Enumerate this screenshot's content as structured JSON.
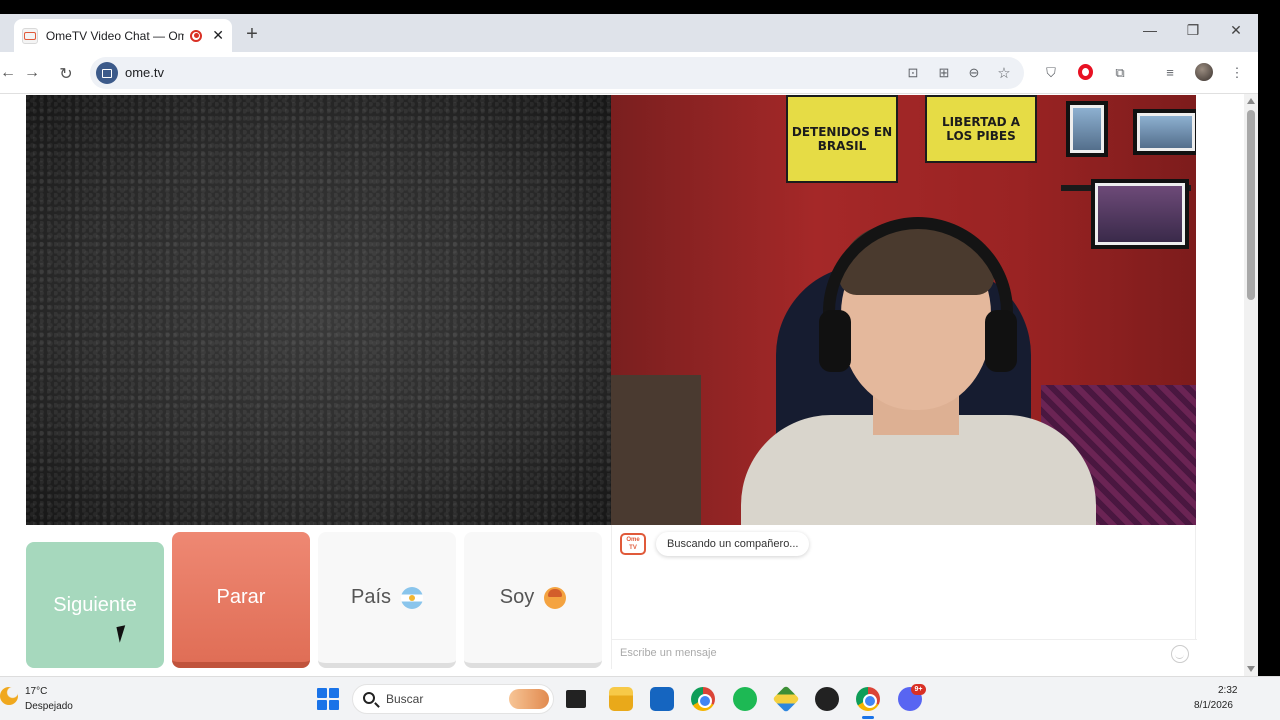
{
  "browser": {
    "tab": {
      "title": "OmeTV Video Chat — Ome",
      "favicon": "ometv-favicon",
      "recording_icon": "recording-icon"
    },
    "url": "ome.tv",
    "accent": "#1a73e8"
  },
  "page": {
    "buttons": {
      "next": "Siguiente",
      "stop": "Parar",
      "country": "País",
      "gender": "Soy"
    },
    "colors": {
      "next": "#a6d8bd",
      "stop": "#e7735c",
      "logo": "#e05a3a"
    },
    "logo_text": "Ome TV",
    "chat": {
      "status": "Buscando un compañero...",
      "placeholder": "Escribe un mensaje"
    },
    "posters": {
      "left": "DETENIDOS EN BRASIL",
      "right": "LIBERTAD A LOS PIBES"
    }
  },
  "taskbar": {
    "weather_temp": "17°C",
    "weather_desc": "Despejado",
    "search_label": "Buscar",
    "notification_badge": "9+",
    "time": "2:32",
    "date": "8/1/2026"
  }
}
